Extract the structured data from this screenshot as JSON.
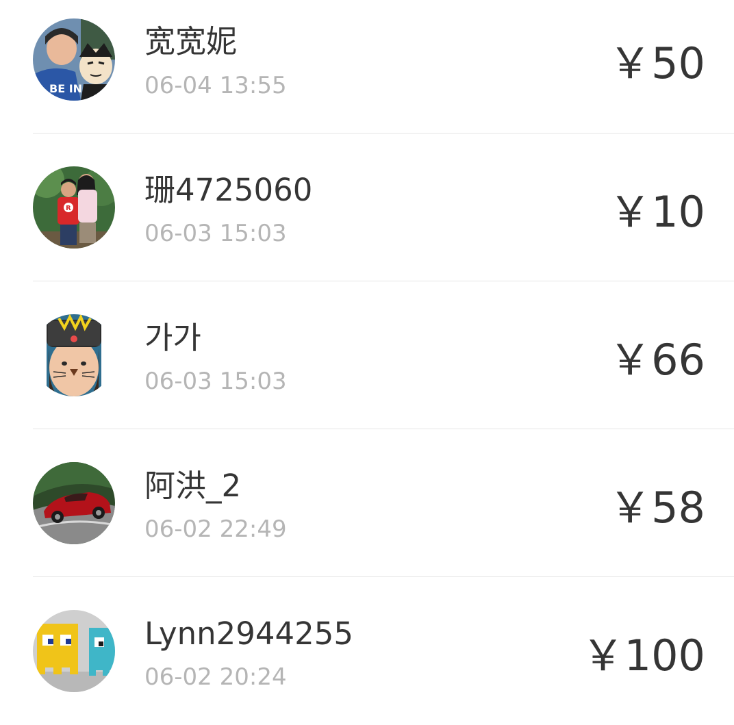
{
  "donations": [
    {
      "name": "宽宽妮",
      "time": "06-04 13:55",
      "amount": "￥50",
      "avatar": "avatar-girl-with-cartoon-mascot"
    },
    {
      "name": "珊4725060",
      "time": "06-03 15:03",
      "amount": "￥10",
      "avatar": "avatar-two-children-outdoors"
    },
    {
      "name": "가가",
      "time": "06-03 15:03",
      "amount": "￥66",
      "avatar": "avatar-girl-with-crown-hat"
    },
    {
      "name": "阿洪_2",
      "time": "06-02 22:49",
      "amount": "￥58",
      "avatar": "avatar-red-sports-car"
    },
    {
      "name": "Lynn2944255",
      "time": "06-02 20:24",
      "amount": "￥100",
      "avatar": "avatar-pixel-ghost-wall-art"
    }
  ],
  "colors": {
    "primary_text": "#353535",
    "secondary_text": "#b5b5b5",
    "divider": "#e5e5e5",
    "background": "#ffffff"
  }
}
